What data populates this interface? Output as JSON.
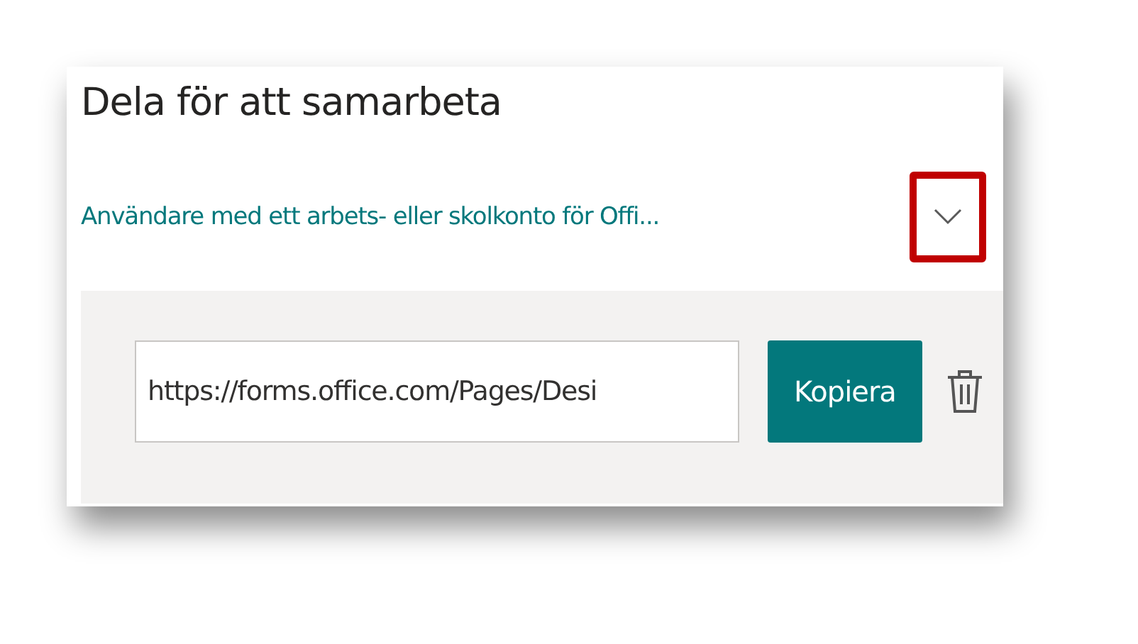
{
  "title": "Dela för att samarbeta",
  "audience_dropdown": {
    "value": "Användare med ett arbets- eller skolkonto för Offi...",
    "highlighted": true
  },
  "link_field": {
    "value": "https://forms.office.com/Pages/Desi"
  },
  "copy_button": {
    "label": "Kopiera"
  }
}
